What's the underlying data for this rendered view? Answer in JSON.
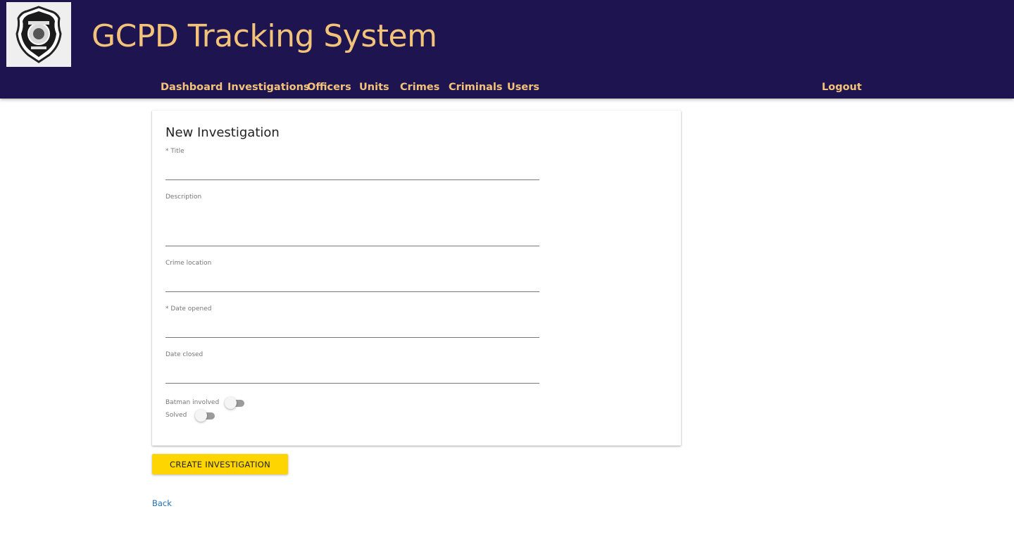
{
  "header": {
    "app_title": "GCPD Tracking System",
    "logo_icon": "police-badge-icon",
    "brand_color": "#1e1450",
    "accent_color": "#f3c37a"
  },
  "nav": {
    "items": [
      {
        "label": "Dashboard"
      },
      {
        "label": "Investigations"
      },
      {
        "label": "Officers"
      },
      {
        "label": "Units"
      },
      {
        "label": "Crimes"
      },
      {
        "label": "Criminals"
      },
      {
        "label": "Users"
      }
    ],
    "logout_label": "Logout"
  },
  "form": {
    "title": "New Investigation",
    "required_marker": "*",
    "fields": {
      "title": {
        "label": "Title",
        "value": ""
      },
      "description": {
        "label": "Description",
        "value": ""
      },
      "crime_location": {
        "label": "Crime location",
        "value": ""
      },
      "date_opened": {
        "label": "Date opened",
        "value": ""
      },
      "date_closed": {
        "label": "Date closed",
        "value": ""
      }
    },
    "toggles": {
      "batman_involved": {
        "label": "Batman involved",
        "checked": false
      },
      "solved": {
        "label": "Solved",
        "checked": false
      }
    },
    "submit_label": "CREATE INVESTIGATION",
    "submit_color": "#ffd500"
  },
  "back_label": "Back"
}
